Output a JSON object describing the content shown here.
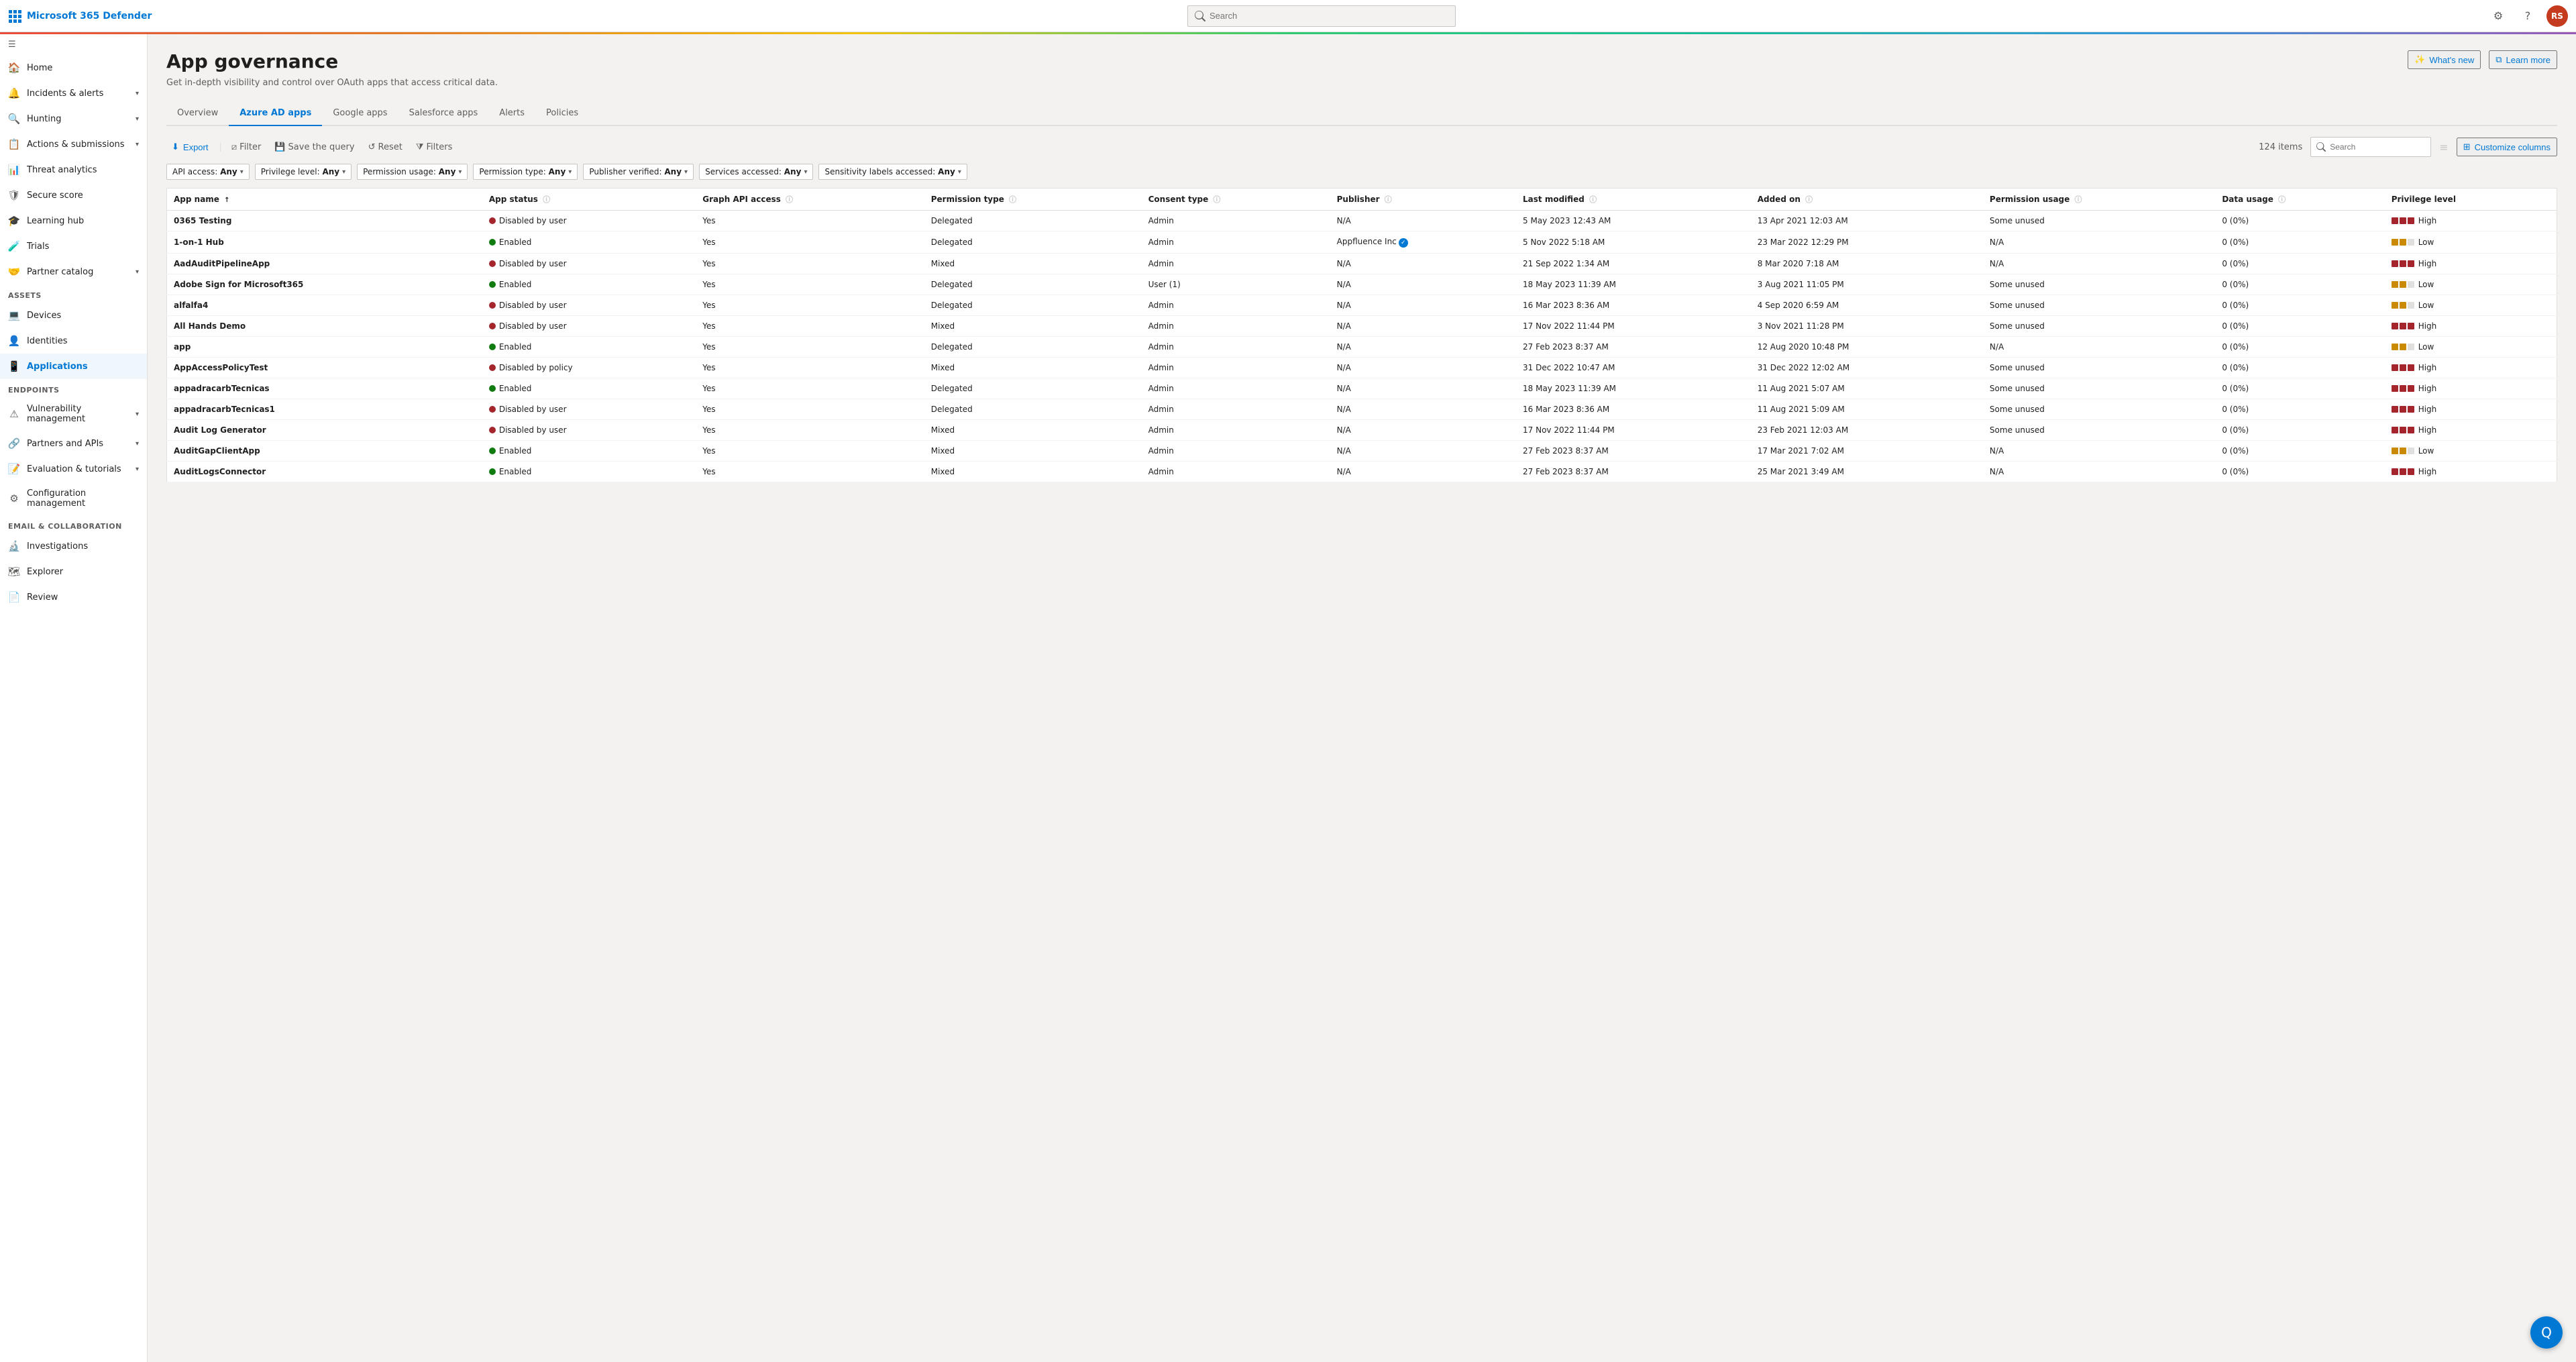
{
  "topbar": {
    "logo_text": "Microsoft 365 Defender",
    "search_placeholder": "Search",
    "gear_label": "⚙",
    "help_label": "?",
    "avatar_text": "RS"
  },
  "sidebar": {
    "toggle_icon": "≡",
    "items": [
      {
        "id": "home",
        "label": "Home",
        "icon": "🏠",
        "expandable": false
      },
      {
        "id": "incidents",
        "label": "Incidents & alerts",
        "icon": "🔔",
        "expandable": true
      },
      {
        "id": "hunting",
        "label": "Hunting",
        "icon": "🔍",
        "expandable": true
      },
      {
        "id": "actions",
        "label": "Actions & submissions",
        "icon": "📋",
        "expandable": true
      },
      {
        "id": "threat",
        "label": "Threat analytics",
        "icon": "📊",
        "expandable": false
      },
      {
        "id": "secure",
        "label": "Secure score",
        "icon": "🛡",
        "expandable": false
      },
      {
        "id": "learning",
        "label": "Learning hub",
        "icon": "🎓",
        "expandable": false
      },
      {
        "id": "trials",
        "label": "Trials",
        "icon": "🧪",
        "expandable": false
      },
      {
        "id": "partner",
        "label": "Partner catalog",
        "icon": "🤝",
        "expandable": true
      },
      {
        "id": "assets_header",
        "label": "Assets",
        "section": true
      },
      {
        "id": "devices",
        "label": "Devices",
        "icon": "💻",
        "expandable": false
      },
      {
        "id": "identities",
        "label": "Identities",
        "icon": "👤",
        "expandable": false
      },
      {
        "id": "applications",
        "label": "Applications",
        "icon": "📱",
        "expandable": false,
        "active": true
      },
      {
        "id": "endpoints_header",
        "label": "Endpoints",
        "section": true
      },
      {
        "id": "vulnerability",
        "label": "Vulnerability management",
        "icon": "⚠",
        "expandable": true
      },
      {
        "id": "partners_apis",
        "label": "Partners and APIs",
        "icon": "🔗",
        "expandable": true
      },
      {
        "id": "evaluation",
        "label": "Evaluation & tutorials",
        "icon": "📝",
        "expandable": true
      },
      {
        "id": "config_mgmt",
        "label": "Configuration management",
        "icon": "⚙",
        "expandable": false
      },
      {
        "id": "email_header",
        "label": "Email & collaboration",
        "section": true
      },
      {
        "id": "investigations",
        "label": "Investigations",
        "icon": "🔬",
        "expandable": false
      },
      {
        "id": "explorer",
        "label": "Explorer",
        "icon": "🗺",
        "expandable": false
      },
      {
        "id": "review",
        "label": "Review",
        "icon": "📄",
        "expandable": false
      }
    ]
  },
  "page": {
    "title": "App governance",
    "subtitle": "Get in-depth visibility and control over OAuth apps that access critical data.",
    "whats_new_label": "What's new",
    "learn_more_label": "Learn more"
  },
  "tabs": [
    {
      "id": "overview",
      "label": "Overview"
    },
    {
      "id": "azure_ad",
      "label": "Azure AD apps",
      "active": true
    },
    {
      "id": "google",
      "label": "Google apps"
    },
    {
      "id": "salesforce",
      "label": "Salesforce apps"
    },
    {
      "id": "alerts",
      "label": "Alerts"
    },
    {
      "id": "policies",
      "label": "Policies"
    }
  ],
  "toolbar": {
    "export_label": "Export",
    "filter_label": "Filter",
    "save_query_label": "Save the query",
    "reset_label": "Reset",
    "filters_label": "Filters",
    "items_count": "124 items",
    "search_placeholder": "Search",
    "customize_columns_label": "Customize columns"
  },
  "filters": [
    {
      "id": "api_access",
      "label": "API access:",
      "value": "Any"
    },
    {
      "id": "privilege_level",
      "label": "Privilege level:",
      "value": "Any"
    },
    {
      "id": "permission_usage",
      "label": "Permission usage:",
      "value": "Any"
    },
    {
      "id": "permission_type",
      "label": "Permission type:",
      "value": "Any"
    },
    {
      "id": "publisher_verified",
      "label": "Publisher verified:",
      "value": "Any"
    },
    {
      "id": "services_accessed",
      "label": "Services accessed:",
      "value": "Any"
    },
    {
      "id": "sensitivity_labels",
      "label": "Sensitivity labels accessed:",
      "value": "Any"
    }
  ],
  "table": {
    "columns": [
      {
        "id": "app_name",
        "label": "App name",
        "sort": "asc"
      },
      {
        "id": "app_status",
        "label": "App status",
        "info": true
      },
      {
        "id": "graph_api",
        "label": "Graph API access",
        "info": true
      },
      {
        "id": "permission_type",
        "label": "Permission type",
        "info": true
      },
      {
        "id": "consent_type",
        "label": "Consent type",
        "info": true
      },
      {
        "id": "publisher",
        "label": "Publisher",
        "info": true
      },
      {
        "id": "last_modified",
        "label": "Last modified",
        "info": true
      },
      {
        "id": "added_on",
        "label": "Added on",
        "info": true
      },
      {
        "id": "permission_usage",
        "label": "Permission usage",
        "info": true
      },
      {
        "id": "data_usage",
        "label": "Data usage",
        "info": true
      },
      {
        "id": "privilege_level",
        "label": "Privilege level"
      }
    ],
    "rows": [
      {
        "app_name": "0365 Testing",
        "app_status": "Disabled by user",
        "status_type": "disabled",
        "graph_api": "Yes",
        "permission_type": "Delegated",
        "consent_type": "Admin",
        "publisher": "N/A",
        "publisher_verified": false,
        "last_modified": "5 May 2023 12:43 AM",
        "added_on": "13 Apr 2021 12:03 AM",
        "permission_usage": "Some unused",
        "data_usage": "0 (0%)",
        "privilege_level": "High",
        "privilege_type": "high"
      },
      {
        "app_name": "1-on-1 Hub",
        "app_status": "Enabled",
        "status_type": "enabled",
        "graph_api": "Yes",
        "permission_type": "Delegated",
        "consent_type": "Admin",
        "publisher": "Appfluence Inc",
        "publisher_verified": true,
        "last_modified": "5 Nov 2022 5:18 AM",
        "added_on": "23 Mar 2022 12:29 PM",
        "permission_usage": "N/A",
        "data_usage": "0 (0%)",
        "privilege_level": "Low",
        "privilege_type": "low"
      },
      {
        "app_name": "AadAuditPipelineApp",
        "app_status": "Disabled by user",
        "status_type": "disabled",
        "graph_api": "Yes",
        "permission_type": "Mixed",
        "consent_type": "Admin",
        "publisher": "N/A",
        "publisher_verified": false,
        "last_modified": "21 Sep 2022 1:34 AM",
        "added_on": "8 Mar 2020 7:18 AM",
        "permission_usage": "N/A",
        "data_usage": "0 (0%)",
        "privilege_level": "High",
        "privilege_type": "high"
      },
      {
        "app_name": "Adobe Sign for Microsoft365",
        "app_status": "Enabled",
        "status_type": "enabled",
        "graph_api": "Yes",
        "permission_type": "Delegated",
        "consent_type": "User (1)",
        "publisher": "N/A",
        "publisher_verified": false,
        "last_modified": "18 May 2023 11:39 AM",
        "added_on": "3 Aug 2021 11:05 PM",
        "permission_usage": "Some unused",
        "data_usage": "0 (0%)",
        "privilege_level": "Low",
        "privilege_type": "low"
      },
      {
        "app_name": "alfalfa4",
        "app_status": "Disabled by user",
        "status_type": "disabled",
        "graph_api": "Yes",
        "permission_type": "Delegated",
        "consent_type": "Admin",
        "publisher": "N/A",
        "publisher_verified": false,
        "last_modified": "16 Mar 2023 8:36 AM",
        "added_on": "4 Sep 2020 6:59 AM",
        "permission_usage": "Some unused",
        "data_usage": "0 (0%)",
        "privilege_level": "Low",
        "privilege_type": "low"
      },
      {
        "app_name": "All Hands Demo",
        "app_status": "Disabled by user",
        "status_type": "disabled",
        "graph_api": "Yes",
        "permission_type": "Mixed",
        "consent_type": "Admin",
        "publisher": "N/A",
        "publisher_verified": false,
        "last_modified": "17 Nov 2022 11:44 PM",
        "added_on": "3 Nov 2021 11:28 PM",
        "permission_usage": "Some unused",
        "data_usage": "0 (0%)",
        "privilege_level": "High",
        "privilege_type": "high"
      },
      {
        "app_name": "app",
        "app_status": "Enabled",
        "status_type": "enabled",
        "graph_api": "Yes",
        "permission_type": "Delegated",
        "consent_type": "Admin",
        "publisher": "N/A",
        "publisher_verified": false,
        "last_modified": "27 Feb 2023 8:37 AM",
        "added_on": "12 Aug 2020 10:48 PM",
        "permission_usage": "N/A",
        "data_usage": "0 (0%)",
        "privilege_level": "Low",
        "privilege_type": "low"
      },
      {
        "app_name": "AppAccessPolicyTest",
        "app_status": "Disabled by policy",
        "status_type": "disabled",
        "graph_api": "Yes",
        "permission_type": "Mixed",
        "consent_type": "Admin",
        "publisher": "N/A",
        "publisher_verified": false,
        "last_modified": "31 Dec 2022 10:47 AM",
        "added_on": "31 Dec 2022 12:02 AM",
        "permission_usage": "Some unused",
        "data_usage": "0 (0%)",
        "privilege_level": "High",
        "privilege_type": "high"
      },
      {
        "app_name": "appadracarbTecnicas",
        "app_status": "Enabled",
        "status_type": "enabled",
        "graph_api": "Yes",
        "permission_type": "Delegated",
        "consent_type": "Admin",
        "publisher": "N/A",
        "publisher_verified": false,
        "last_modified": "18 May 2023 11:39 AM",
        "added_on": "11 Aug 2021 5:07 AM",
        "permission_usage": "Some unused",
        "data_usage": "0 (0%)",
        "privilege_level": "High",
        "privilege_type": "high"
      },
      {
        "app_name": "appadracarbTecnicas1",
        "app_status": "Disabled by user",
        "status_type": "disabled",
        "graph_api": "Yes",
        "permission_type": "Delegated",
        "consent_type": "Admin",
        "publisher": "N/A",
        "publisher_verified": false,
        "last_modified": "16 Mar 2023 8:36 AM",
        "added_on": "11 Aug 2021 5:09 AM",
        "permission_usage": "Some unused",
        "data_usage": "0 (0%)",
        "privilege_level": "High",
        "privilege_type": "high"
      },
      {
        "app_name": "Audit Log Generator",
        "app_status": "Disabled by user",
        "status_type": "disabled",
        "graph_api": "Yes",
        "permission_type": "Mixed",
        "consent_type": "Admin",
        "publisher": "N/A",
        "publisher_verified": false,
        "last_modified": "17 Nov 2022 11:44 PM",
        "added_on": "23 Feb 2021 12:03 AM",
        "permission_usage": "Some unused",
        "data_usage": "0 (0%)",
        "privilege_level": "High",
        "privilege_type": "high"
      },
      {
        "app_name": "AuditGapClientApp",
        "app_status": "Enabled",
        "status_type": "enabled",
        "graph_api": "Yes",
        "permission_type": "Mixed",
        "consent_type": "Admin",
        "publisher": "N/A",
        "publisher_verified": false,
        "last_modified": "27 Feb 2023 8:37 AM",
        "added_on": "17 Mar 2021 7:02 AM",
        "permission_usage": "N/A",
        "data_usage": "0 (0%)",
        "privilege_level": "Low",
        "privilege_type": "low"
      },
      {
        "app_name": "AuditLogsConnector",
        "app_status": "Enabled",
        "status_type": "enabled",
        "graph_api": "Yes",
        "permission_type": "Mixed",
        "consent_type": "Admin",
        "publisher": "N/A",
        "publisher_verified": false,
        "last_modified": "27 Feb 2023 8:37 AM",
        "added_on": "25 Mar 2021 3:49 AM",
        "permission_usage": "N/A",
        "data_usage": "0 (0%)",
        "privilege_level": "High",
        "privilege_type": "high"
      }
    ]
  },
  "chat_fab_label": "Q"
}
